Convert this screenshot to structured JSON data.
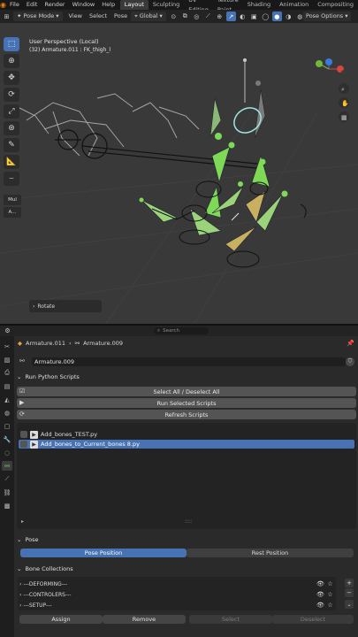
{
  "topbar": {
    "menus": [
      "File",
      "Edit",
      "Render",
      "Window",
      "Help"
    ],
    "workspaces": [
      "Layout",
      "Sculpting",
      "UV Editing",
      "Texture Paint",
      "Shading",
      "Animation",
      "Compositing"
    ],
    "active_workspace": "Layout"
  },
  "header": {
    "mode": "Pose Mode",
    "menus": [
      "View",
      "Select",
      "Pose"
    ],
    "orientation": "Global",
    "pose_options": "Pose Options"
  },
  "viewport": {
    "title": "User Perspective (Local)",
    "subtitle": "(32) Armature.011 : FK_thigh_l",
    "side_tab_1": "Mul",
    "side_tab_2": "A...",
    "last_op": "Rotate"
  },
  "properties": {
    "search_placeholder": "Search",
    "breadcrumb_1": "Armature.011",
    "breadcrumb_2": "Armature.009",
    "name_field": "Armature.009",
    "panel_run_scripts": "Run Python Scripts",
    "btn_select_all": "Select All / Deselect All",
    "btn_run_selected": "Run Selected Scripts",
    "btn_refresh": "Refresh Scripts",
    "scripts": [
      {
        "name": "Add_bones_TEST.py",
        "selected": false
      },
      {
        "name": "Add_bones_to_Current_bones 8.py",
        "selected": true
      }
    ],
    "list_grip": "::::",
    "panel_pose": "Pose",
    "pose_position": "Pose Position",
    "rest_position": "Rest Position",
    "panel_bone_collections": "Bone Collections",
    "bone_collections": [
      "---DEFORMING---",
      "---CONTROLERS---",
      "---SETUP---"
    ],
    "assign": "Assign",
    "remove": "Remove",
    "select": "Select",
    "deselect": "Deselect"
  },
  "colors": {
    "accent_blue": "#4772b3",
    "bone_green": "#7ed957",
    "orange": "#e87d0d"
  }
}
